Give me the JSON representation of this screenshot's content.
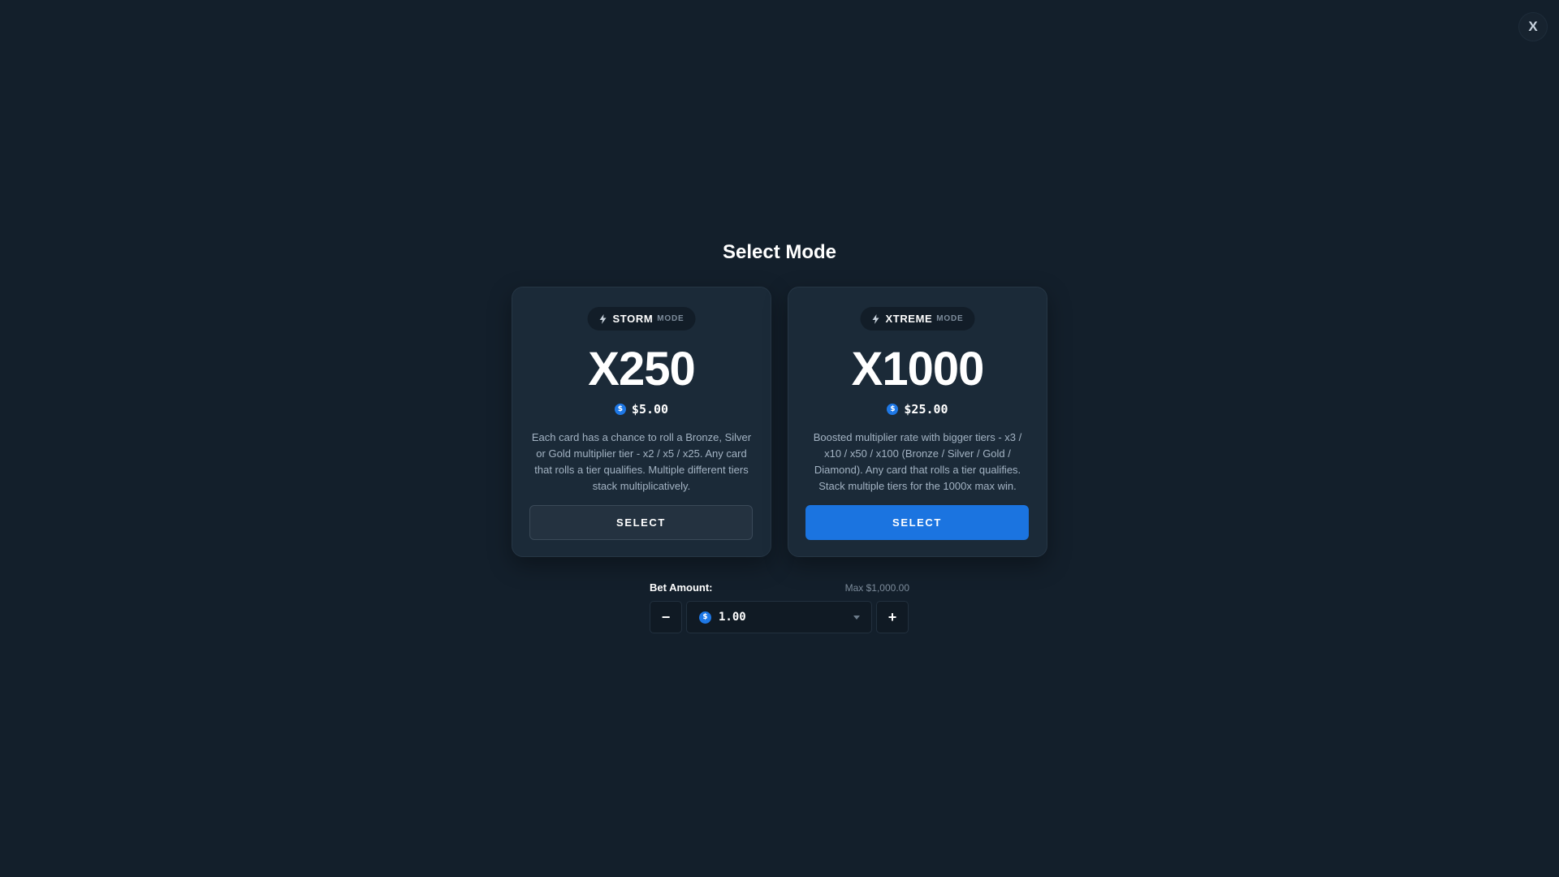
{
  "close_label": "X",
  "title": "Select Mode",
  "modes": [
    {
      "name": "STORM",
      "suffix": "MODE",
      "multiplier": "X250",
      "currency_symbol": "$",
      "price": "$5.00",
      "description": "Each card has a chance to roll a Bronze, Silver or Gold multiplier tier - x2 / x5 / x25. Any card that rolls a tier qualifies. Multiple different tiers stack multiplicatively.",
      "button_label": "SELECT",
      "button_style": "secondary"
    },
    {
      "name": "XTREME",
      "suffix": "MODE",
      "multiplier": "X1000",
      "currency_symbol": "$",
      "price": "$25.00",
      "description": "Boosted multiplier rate with bigger tiers - x3 / x10 / x50 / x100 (Bronze / Silver / Gold / Diamond). Any card that rolls a tier qualifies. Stack multiple tiers for the 1000x max win.",
      "button_label": "SELECT",
      "button_style": "primary"
    }
  ],
  "bet": {
    "label": "Bet Amount:",
    "max": "Max $1,000.00",
    "value": "1.00",
    "currency_symbol": "$",
    "minus_label": "−",
    "plus_label": "+"
  },
  "colors": {
    "background": "#131f2b",
    "card": "#1b2a38",
    "accent": "#1b74e0"
  }
}
